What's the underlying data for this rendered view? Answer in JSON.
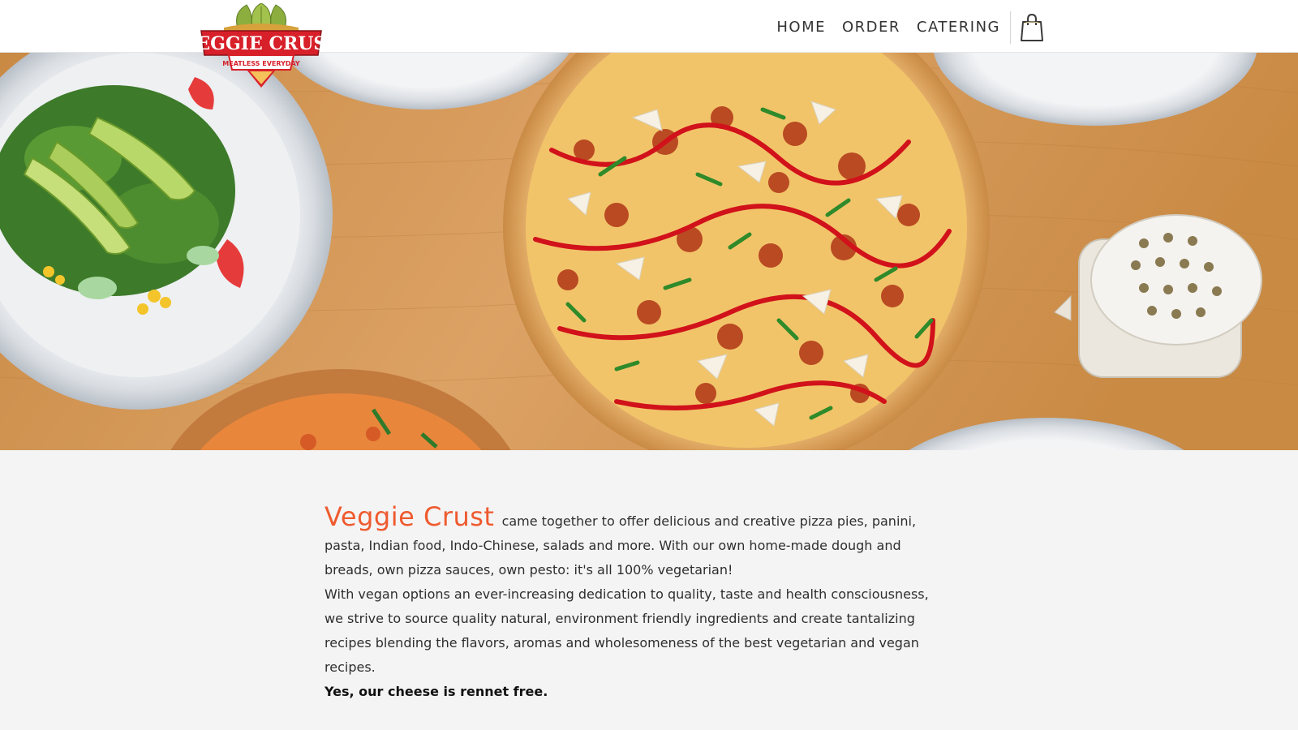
{
  "logo": {
    "title": "VEGGIE CRUST",
    "tagline": "MEATLESS EVERYDAY"
  },
  "nav": {
    "items": [
      {
        "label": "HOME"
      },
      {
        "label": "ORDER"
      },
      {
        "label": "CATERING"
      }
    ],
    "cart_icon": "shopping-bag-icon"
  },
  "hero": {
    "image": "food-photo: salad plates, pizza, cheese shaker on wooden table"
  },
  "about": {
    "brand": "Veggie Crust",
    "intro": "came together to offer delicious and creative pizza pies, panini, pasta, Indian food, Indo-Chinese, salads and more. With our own home-made dough and breads, own pizza sauces, own pesto: it's all 100% vegetarian!",
    "mission": "With vegan options an ever-increasing dedication to quality, taste and health consciousness, we strive to source quality natural, environment friendly ingredients and create tantalizing recipes blending the flavors, aromas and wholesomeness of the best vegetarian and vegan recipes.",
    "note": "Yes, our cheese is rennet free."
  },
  "colors": {
    "brand_orange": "#ef5a2f",
    "logo_red": "#d8202a",
    "logo_green": "#8cae3f",
    "background": "#f4f4f4"
  }
}
